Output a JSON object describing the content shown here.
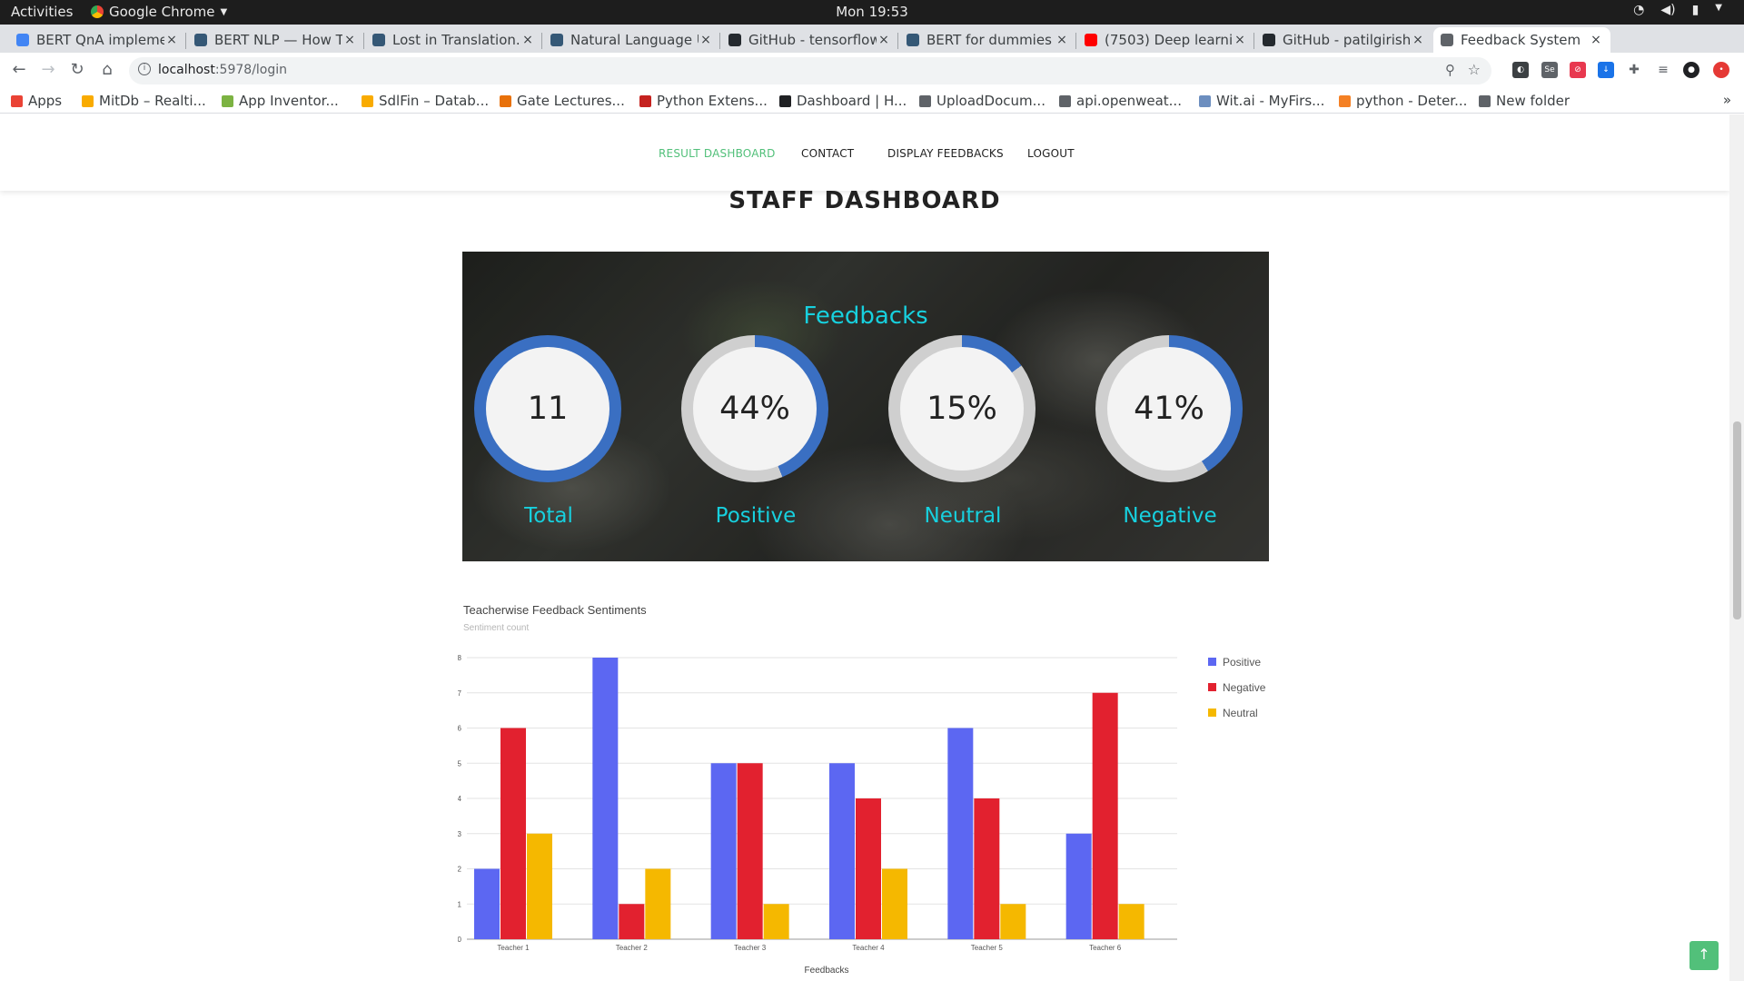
{
  "os_bar": {
    "activities": "Activities",
    "app_name": "Google Chrome",
    "clock": "Mon 19:53"
  },
  "tabs": [
    {
      "label": "BERT QnA impleme",
      "favicon": "google-icon",
      "color": "#4285f4"
    },
    {
      "label": "BERT NLP — How T",
      "favicon": "tds-icon",
      "color": "#355876"
    },
    {
      "label": "Lost in Translation.",
      "favicon": "tds-icon",
      "color": "#355876"
    },
    {
      "label": "Natural Language U",
      "favicon": "tds-icon",
      "color": "#355876"
    },
    {
      "label": "GitHub - tensorflow",
      "favicon": "github-icon",
      "color": "#24292e"
    },
    {
      "label": "BERT for dummies",
      "favicon": "tds-icon",
      "color": "#355876"
    },
    {
      "label": "(7503) Deep learnin",
      "favicon": "youtube-icon",
      "color": "#ff0000"
    },
    {
      "label": "GitHub - patilgirish",
      "favicon": "github-icon",
      "color": "#24292e"
    },
    {
      "label": "Feedback System",
      "favicon": "globe-icon",
      "color": "#5f6368"
    }
  ],
  "url": {
    "host": "localhost",
    "path": ":5978/login"
  },
  "bookmarks": [
    {
      "label": "Apps",
      "color": "#ea4335"
    },
    {
      "label": "MitDb – Realti...",
      "color": "#f9ab00"
    },
    {
      "label": "App Inventor...",
      "color": "#7cb342"
    },
    {
      "label": "SdlFin – Datab...",
      "color": "#f9ab00"
    },
    {
      "label": "Gate Lectures...",
      "color": "#e8710a"
    },
    {
      "label": "Python Extens...",
      "color": "#c5221f"
    },
    {
      "label": "Dashboard | H...",
      "color": "#202124"
    },
    {
      "label": "UploadDocum...",
      "color": "#5f6368"
    },
    {
      "label": "api.openweat...",
      "color": "#5f6368"
    },
    {
      "label": "Wit.ai - MyFirs...",
      "color": "#6c8ebf"
    },
    {
      "label": "python - Deter...",
      "color": "#f48024"
    },
    {
      "label": "New folder",
      "color": "#5f6368"
    }
  ],
  "bookmarks_more": "»",
  "site_nav": [
    {
      "label": "RESULT DASHBOARD",
      "active": true
    },
    {
      "label": "CONTACT",
      "active": false
    },
    {
      "label": "DISPLAY FEEDBACKS",
      "active": false
    },
    {
      "label": "LOGOUT",
      "active": false
    }
  ],
  "page_title": "STAFF DASHBOARD",
  "stats": {
    "title": "Feedbacks",
    "items": [
      {
        "value": "11",
        "label": "Total",
        "fraction": 1.0
      },
      {
        "value": "44%",
        "label": "Positive",
        "fraction": 0.44
      },
      {
        "value": "15%",
        "label": "Neutral",
        "fraction": 0.15
      },
      {
        "value": "41%",
        "label": "Negative",
        "fraction": 0.41
      }
    ],
    "ring_color": "#3a6fc2",
    "ring_track": "#cfcfcf",
    "accent_text": "#17d0de"
  },
  "chart_data": {
    "type": "bar",
    "title": "Teacherwise Feedback Sentiments",
    "subtitle": "Sentiment count",
    "xlabel": "Feedbacks",
    "categories": [
      "Teacher 1",
      "Teacher 2",
      "Teacher 3",
      "Teacher 4",
      "Teacher 5",
      "Teacher 6"
    ],
    "series": [
      {
        "name": "Positive",
        "color": "#5c67f2",
        "values": [
          2,
          8,
          5,
          5,
          6,
          3
        ]
      },
      {
        "name": "Negative",
        "color": "#e2212f",
        "values": [
          6,
          1,
          5,
          4,
          4,
          7
        ]
      },
      {
        "name": "Neutral",
        "color": "#f5b800",
        "values": [
          3,
          2,
          1,
          2,
          1,
          1
        ]
      }
    ],
    "ylim": [
      0,
      8
    ],
    "yticks": [
      "0",
      "1",
      "2",
      "3",
      "4",
      "5",
      "6",
      "7",
      "8"
    ],
    "grid": true,
    "legend": "right"
  },
  "scroll_top_icon": "↑"
}
